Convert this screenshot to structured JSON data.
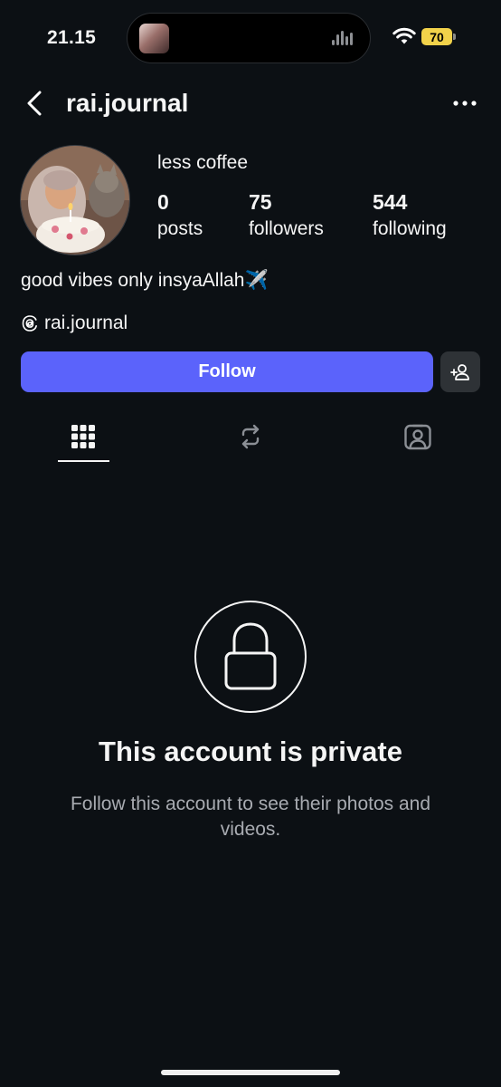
{
  "status_bar": {
    "time": "21.15",
    "battery": "70",
    "battery_color": "#f2d24a"
  },
  "header": {
    "username": "rai.journal",
    "back_icon": "chevron-left-icon",
    "more_icon": "more-horizontal-icon"
  },
  "profile": {
    "display_name": "less coffee",
    "stats": [
      {
        "value": "0",
        "label": "posts"
      },
      {
        "value": "75",
        "label": "followers"
      },
      {
        "value": "544",
        "label": "following"
      }
    ],
    "bio": "good vibes only insyaAllah✈️",
    "threads_handle": "rai.journal"
  },
  "actions": {
    "follow_label": "Follow",
    "follow_color": "#5b63fb",
    "suggest_icon": "add-person-icon"
  },
  "tabs": [
    {
      "icon": "grid-icon",
      "active": true
    },
    {
      "icon": "reels-repost-icon",
      "active": false
    },
    {
      "icon": "tagged-person-icon",
      "active": false
    }
  ],
  "private": {
    "title": "This account is private",
    "subtitle": "Follow this account to see their photos and videos."
  }
}
